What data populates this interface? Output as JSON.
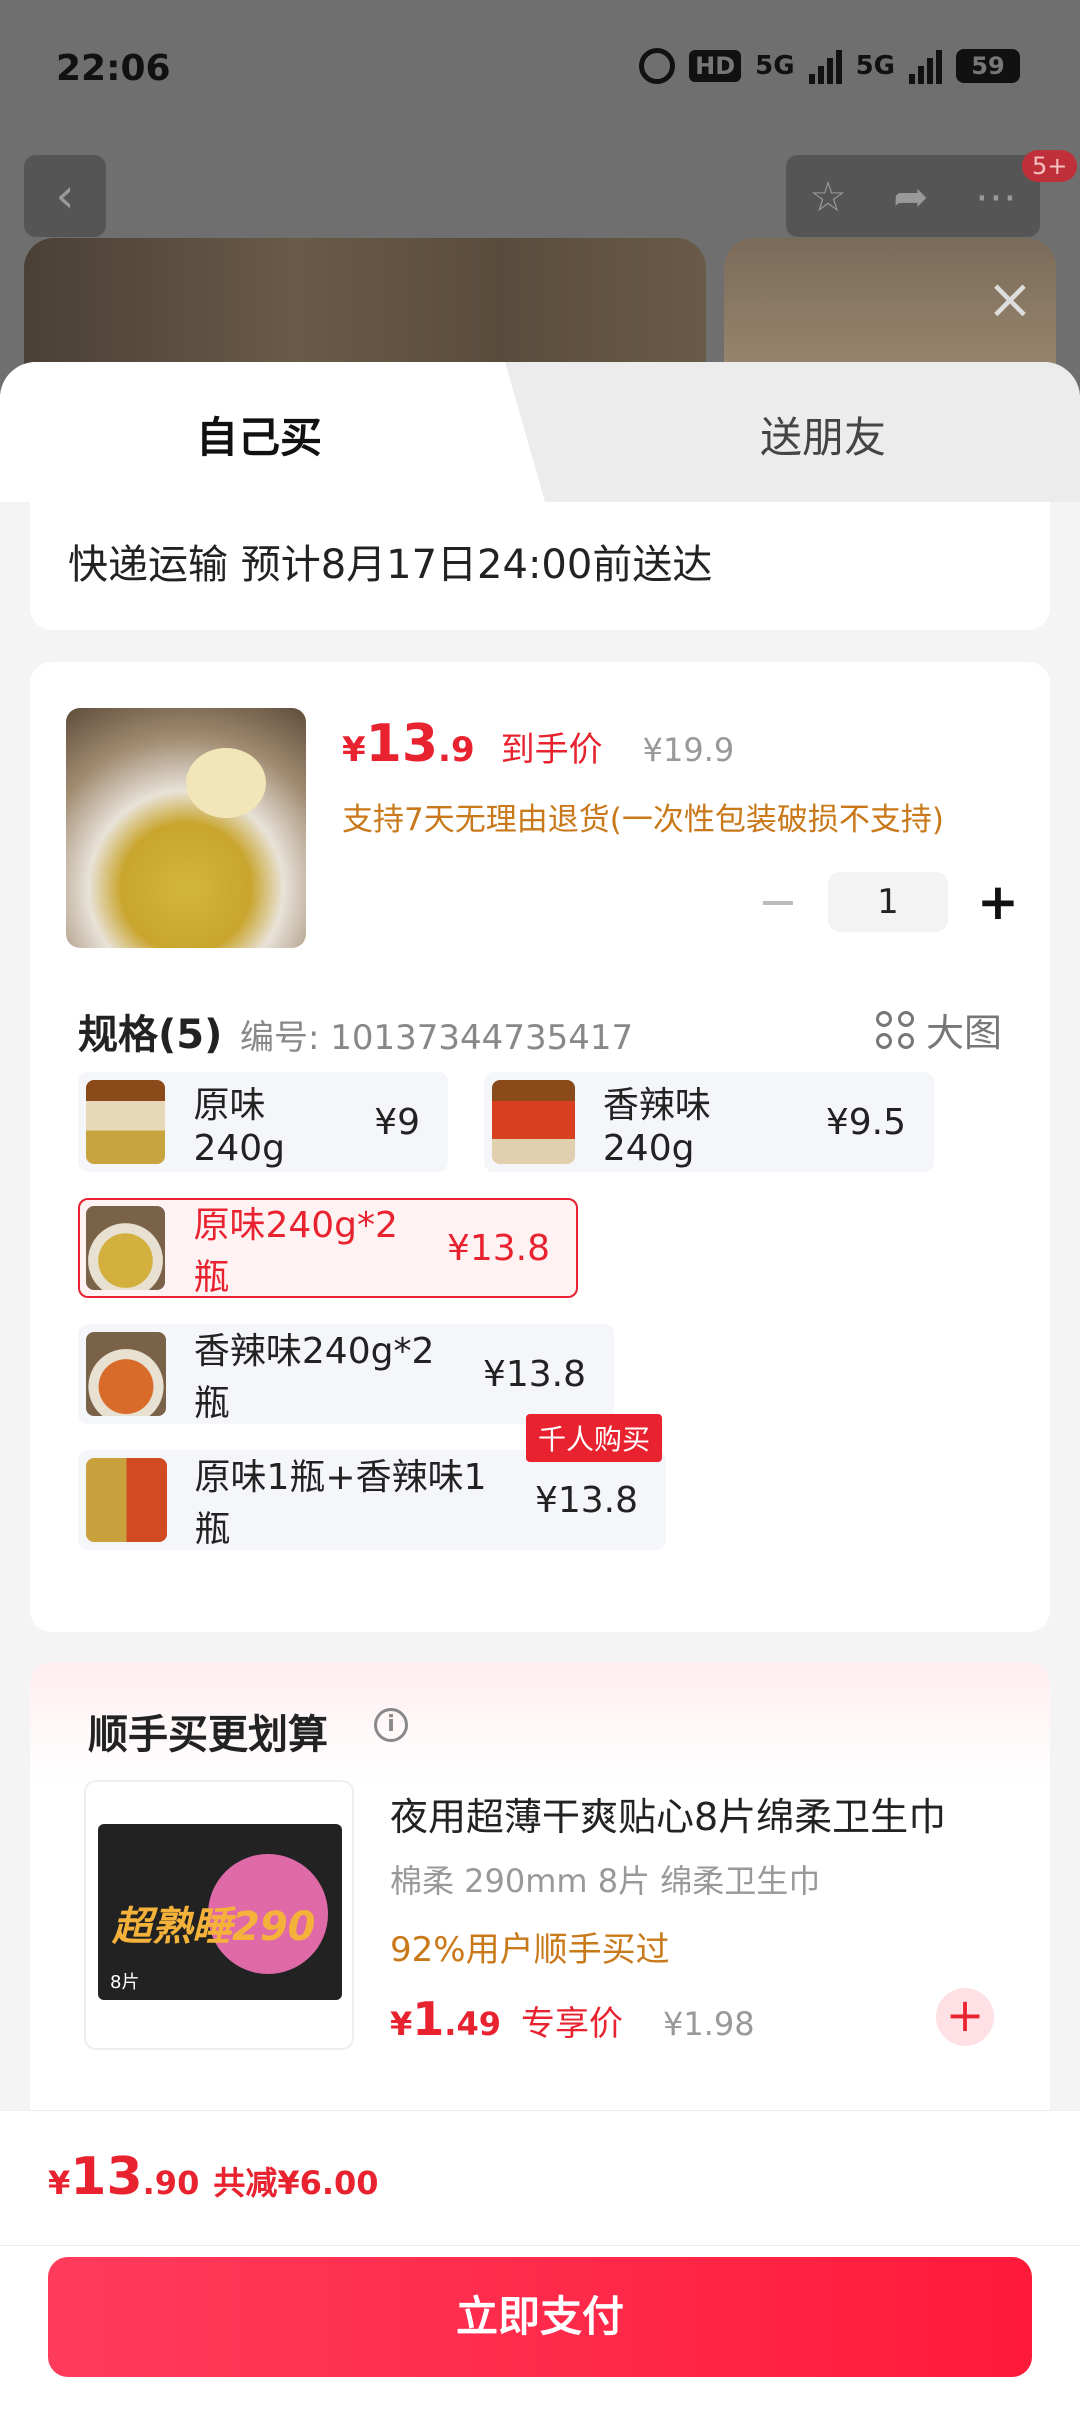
{
  "status_bar": {
    "time": "22:06",
    "hd_label": "HD",
    "network_1": "5G",
    "network_2": "5G",
    "battery": "59"
  },
  "top_actions": {
    "notification_badge": "5+"
  },
  "tabs": [
    {
      "label": "自己买",
      "active": true
    },
    {
      "label": "送朋友",
      "active": false
    }
  ],
  "delivery": {
    "text": "快递运输 预计8月17日24:00前送达"
  },
  "product": {
    "price_symbol": "¥",
    "price_int": "13",
    "price_dec": ".9",
    "price_tag": "到手价",
    "original_price": "¥19.9",
    "return_note": "支持7天无理由退货(一次性包装破损不支持)",
    "quantity": "1"
  },
  "spec": {
    "title": "规格(5)",
    "code": "编号: 10137344735417",
    "big_view_label": "大图",
    "options": [
      {
        "label": "原味240g",
        "price": "¥9",
        "selected": false
      },
      {
        "label": "香辣味240g",
        "price": "¥9.5",
        "selected": false
      },
      {
        "label": "原味240g*2瓶",
        "price": "¥13.8",
        "selected": true
      },
      {
        "label": "香辣味240g*2瓶",
        "price": "¥13.8",
        "selected": false
      },
      {
        "label": "原味1瓶+香辣味1瓶",
        "price": "¥13.8",
        "selected": false,
        "badge": "千人购买"
      }
    ]
  },
  "addon": {
    "title": "顺手买更划算",
    "name": "夜用超薄干爽贴心8片绵柔卫生巾",
    "subtitle": "棉柔 290mm 8片 绵柔卫生巾",
    "bought": "92%用户顺手买过",
    "price_symbol": "¥",
    "price_int": "1",
    "price_dec": ".49",
    "price_tag": "专享价",
    "original_price": "¥1.98",
    "package_text": "超熟睡290",
    "package_count": "8片"
  },
  "footer": {
    "total_symbol": "¥",
    "total_int": "13",
    "total_dec": ".90",
    "discount": "共减¥6.00",
    "pay_label": "立即支付"
  },
  "colors": {
    "accent": "#e8232f",
    "orange_note": "#c9781a",
    "pay_gradient_start": "#ff3b5c",
    "pay_gradient_end": "#ff1a3a"
  }
}
